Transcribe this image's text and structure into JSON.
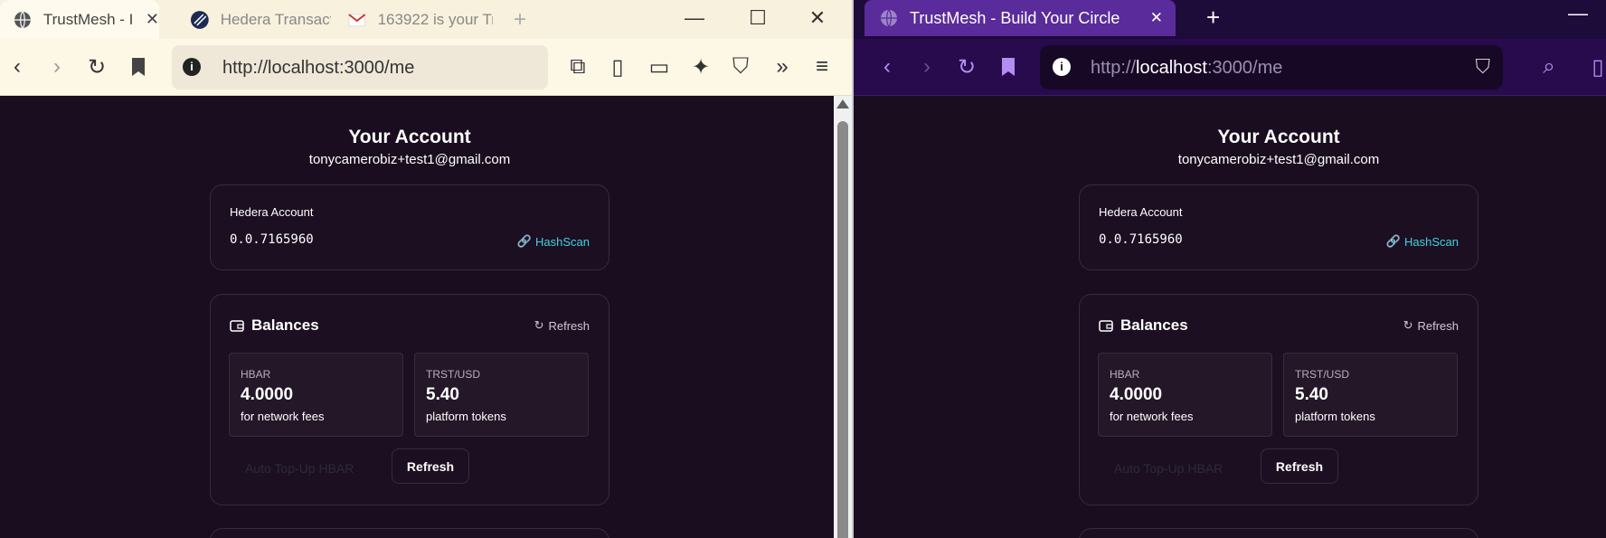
{
  "left_browser": {
    "tabs": [
      {
        "label": "TrustMesh - I"
      },
      {
        "label": "Hedera Transactio"
      },
      {
        "label": "163922 is your Tr"
      }
    ],
    "url": "http://localhost:3000/me"
  },
  "right_browser": {
    "tab": {
      "label": "TrustMesh - Build Your Circle"
    },
    "url_prefix": "http://",
    "url_host": "localhost",
    "url_suffix": ":3000/me"
  },
  "page": {
    "title": "Your Account",
    "email": "tonycamerobiz+test1@gmail.com",
    "hedera_label": "Hedera Account",
    "account_id": "0.0.7165960",
    "hashscan_label": "HashScan",
    "balances_title": "Balances",
    "refresh_label": "Refresh",
    "tiles": [
      {
        "name": "HBAR",
        "value": "4.0000",
        "desc": "for network fees"
      },
      {
        "name": "TRST/USD",
        "value": "5.40",
        "desc": "platform tokens"
      }
    ],
    "auto_topup_label": "Auto Top-Up HBAR",
    "refresh_button_label": "Refresh"
  },
  "colors": {
    "accent": "#3fd3e0",
    "brave_tab": "#5a2b9a",
    "bg": "#1a0d1f"
  }
}
